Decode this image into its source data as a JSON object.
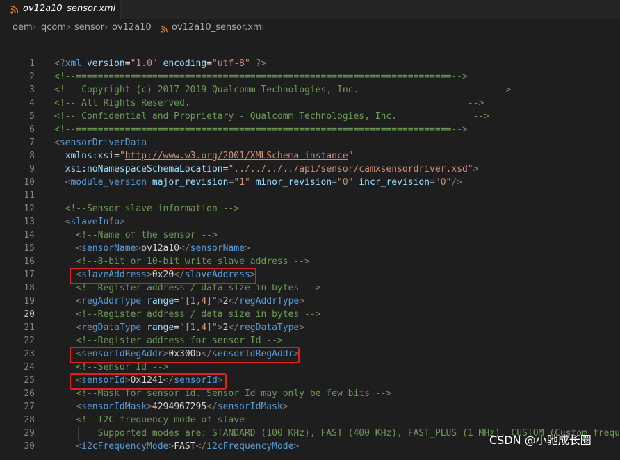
{
  "tab": {
    "label": "ov12a10_sensor.xml",
    "icon": "rss-icon",
    "icon_color": "#e37933"
  },
  "breadcrumb": {
    "items": [
      "oem",
      "qcom",
      "sensor",
      "ov12a10",
      "ov12a10_sensor.xml"
    ]
  },
  "editor": {
    "active_line": 20,
    "lines": [
      {
        "n": "1",
        "parts": [
          [
            "punct",
            "<?"
          ],
          [
            "tag",
            "xml"
          ],
          [
            "text",
            " "
          ],
          [
            "attr",
            "version"
          ],
          [
            "text",
            "="
          ],
          [
            "val",
            "\"1.0\""
          ],
          [
            "text",
            " "
          ],
          [
            "attr",
            "encoding"
          ],
          [
            "text",
            "="
          ],
          [
            "val",
            "\"utf-8\""
          ],
          [
            "text",
            " "
          ],
          [
            "punct",
            "?>"
          ]
        ]
      },
      {
        "n": "2",
        "parts": [
          [
            "com",
            "<!--=====================================================================-->"
          ]
        ]
      },
      {
        "n": "3",
        "parts": [
          [
            "com",
            "<!-- Copyright (c) 2017-2019 Qualcomm Technologies, Inc.                         -->"
          ]
        ]
      },
      {
        "n": "4",
        "parts": [
          [
            "com",
            "<!-- All Rights Reserved.                                                   -->"
          ]
        ]
      },
      {
        "n": "5",
        "parts": [
          [
            "com",
            "<!-- Confidential and Proprietary - Qualcomm Technologies, Inc.              -->"
          ]
        ]
      },
      {
        "n": "6",
        "parts": [
          [
            "com",
            "<!--=====================================================================-->"
          ]
        ]
      },
      {
        "n": "7",
        "parts": [
          [
            "punct",
            "<"
          ],
          [
            "tag",
            "sensorDriverData"
          ]
        ]
      },
      {
        "n": "8",
        "parts": [
          [
            "text",
            "  "
          ],
          [
            "attr",
            "xmlns:xsi"
          ],
          [
            "text",
            "="
          ],
          [
            "val",
            "\""
          ],
          [
            "url",
            "http://www.w3.org/2001/XMLSchema-instance"
          ],
          [
            "val",
            "\""
          ]
        ]
      },
      {
        "n": "9",
        "parts": [
          [
            "text",
            "  "
          ],
          [
            "attr",
            "xsi:noNamespaceSchemaLocation"
          ],
          [
            "text",
            "="
          ],
          [
            "val",
            "\"../../../../api/sensor/camxsensordriver.xsd\""
          ],
          [
            "punct",
            ">"
          ]
        ]
      },
      {
        "n": "10",
        "parts": [
          [
            "text",
            "  "
          ],
          [
            "punct",
            "<"
          ],
          [
            "tag",
            "module_version"
          ],
          [
            "text",
            " "
          ],
          [
            "attr",
            "major_revision"
          ],
          [
            "text",
            "="
          ],
          [
            "val",
            "\"1\""
          ],
          [
            "text",
            " "
          ],
          [
            "attr",
            "minor_revision"
          ],
          [
            "text",
            "="
          ],
          [
            "val",
            "\"0\""
          ],
          [
            "text",
            " "
          ],
          [
            "attr",
            "incr_revision"
          ],
          [
            "text",
            "="
          ],
          [
            "val",
            "\"0\""
          ],
          [
            "punct",
            "/>"
          ]
        ]
      },
      {
        "n": "11",
        "parts": []
      },
      {
        "n": "12",
        "parts": [
          [
            "text",
            "  "
          ],
          [
            "com",
            "<!--Sensor slave information -->"
          ]
        ]
      },
      {
        "n": "13",
        "parts": [
          [
            "text",
            "  "
          ],
          [
            "punct",
            "<"
          ],
          [
            "tag",
            "slaveInfo"
          ],
          [
            "punct",
            ">"
          ]
        ]
      },
      {
        "n": "14",
        "parts": [
          [
            "text",
            "    "
          ],
          [
            "com",
            "<!--Name of the sensor -->"
          ]
        ]
      },
      {
        "n": "15",
        "parts": [
          [
            "text",
            "    "
          ],
          [
            "punct",
            "<"
          ],
          [
            "tag",
            "sensorName"
          ],
          [
            "punct",
            ">"
          ],
          [
            "text",
            "ov12a10"
          ],
          [
            "punct",
            "</"
          ],
          [
            "tag",
            "sensorName"
          ],
          [
            "punct",
            ">"
          ]
        ]
      },
      {
        "n": "16",
        "parts": [
          [
            "text",
            "    "
          ],
          [
            "com",
            "<!--8-bit or 10-bit write slave address -->"
          ]
        ]
      },
      {
        "n": "17",
        "parts": [
          [
            "text",
            "    "
          ],
          [
            "punct",
            "<"
          ],
          [
            "tag",
            "slaveAddress"
          ],
          [
            "punct",
            ">"
          ],
          [
            "text",
            "0x20"
          ],
          [
            "punct",
            "</"
          ],
          [
            "tag",
            "slaveAddress"
          ],
          [
            "punct",
            ">"
          ]
        ]
      },
      {
        "n": "18",
        "parts": [
          [
            "text",
            "    "
          ],
          [
            "com",
            "<!--Register address / data size in bytes -->"
          ]
        ]
      },
      {
        "n": "19",
        "parts": [
          [
            "text",
            "    "
          ],
          [
            "punct",
            "<"
          ],
          [
            "tag",
            "regAddrType"
          ],
          [
            "text",
            " "
          ],
          [
            "attr",
            "range"
          ],
          [
            "text",
            "="
          ],
          [
            "val",
            "\"[1,4]\""
          ],
          [
            "punct",
            ">"
          ],
          [
            "text",
            "2"
          ],
          [
            "punct",
            "</"
          ],
          [
            "tag",
            "regAddrType"
          ],
          [
            "punct",
            ">"
          ]
        ]
      },
      {
        "n": "20",
        "parts": [
          [
            "text",
            "    "
          ],
          [
            "com",
            "<!--Register address / data size in bytes -->"
          ]
        ]
      },
      {
        "n": "21",
        "parts": [
          [
            "text",
            "    "
          ],
          [
            "punct",
            "<"
          ],
          [
            "tag",
            "regDataType"
          ],
          [
            "text",
            " "
          ],
          [
            "attr",
            "range"
          ],
          [
            "text",
            "="
          ],
          [
            "val",
            "\"[1,4]\""
          ],
          [
            "punct",
            ">"
          ],
          [
            "text",
            "2"
          ],
          [
            "punct",
            "</"
          ],
          [
            "tag",
            "regDataType"
          ],
          [
            "punct",
            ">"
          ]
        ]
      },
      {
        "n": "22",
        "parts": [
          [
            "text",
            "    "
          ],
          [
            "com",
            "<!--Register address for sensor Id -->"
          ]
        ]
      },
      {
        "n": "23",
        "parts": [
          [
            "text",
            "    "
          ],
          [
            "punct",
            "<"
          ],
          [
            "tag",
            "sensorIdRegAddr"
          ],
          [
            "punct",
            ">"
          ],
          [
            "text",
            "0x300b"
          ],
          [
            "punct",
            "</"
          ],
          [
            "tag",
            "sensorIdRegAddr"
          ],
          [
            "punct",
            ">"
          ]
        ]
      },
      {
        "n": "24",
        "parts": [
          [
            "text",
            "    "
          ],
          [
            "com",
            "<!--Sensor Id -->"
          ]
        ]
      },
      {
        "n": "25",
        "parts": [
          [
            "text",
            "    "
          ],
          [
            "punct",
            "<"
          ],
          [
            "tag",
            "sensorId"
          ],
          [
            "punct",
            ">"
          ],
          [
            "text",
            "0x1241"
          ],
          [
            "punct",
            "</"
          ],
          [
            "tag",
            "sensorId"
          ],
          [
            "punct",
            ">"
          ]
        ]
      },
      {
        "n": "26",
        "parts": [
          [
            "text",
            "    "
          ],
          [
            "com",
            "<!--Mask for sensor id. Sensor Id may only be few bits -->"
          ]
        ]
      },
      {
        "n": "27",
        "parts": [
          [
            "text",
            "    "
          ],
          [
            "punct",
            "<"
          ],
          [
            "tag",
            "sensorIdMask"
          ],
          [
            "punct",
            ">"
          ],
          [
            "text",
            "4294967295"
          ],
          [
            "punct",
            "</"
          ],
          [
            "tag",
            "sensorIdMask"
          ],
          [
            "punct",
            ">"
          ]
        ]
      },
      {
        "n": "28",
        "parts": [
          [
            "text",
            "    "
          ],
          [
            "com",
            "<!--I2C frequency mode of slave"
          ]
        ]
      },
      {
        "n": "29",
        "parts": [
          [
            "text",
            "        "
          ],
          [
            "com",
            "Supported modes are: STANDARD (100 KHz), FAST (400 KHz), FAST_PLUS (1 MHz), CUSTOM (Custom frequen"
          ]
        ]
      },
      {
        "n": "30",
        "parts": [
          [
            "text",
            "    "
          ],
          [
            "punct",
            "<"
          ],
          [
            "tag",
            "i2cFrequencyMode"
          ],
          [
            "punct",
            ">"
          ],
          [
            "text",
            "FAST"
          ],
          [
            "punct",
            "</"
          ],
          [
            "tag",
            "i2cFrequencyMode"
          ],
          [
            "punct",
            ">"
          ]
        ]
      }
    ]
  },
  "watermark": "CSDN @小驰成长圈",
  "colors": {
    "highlight_box": "#e02020",
    "background": "#1e1e1e"
  }
}
